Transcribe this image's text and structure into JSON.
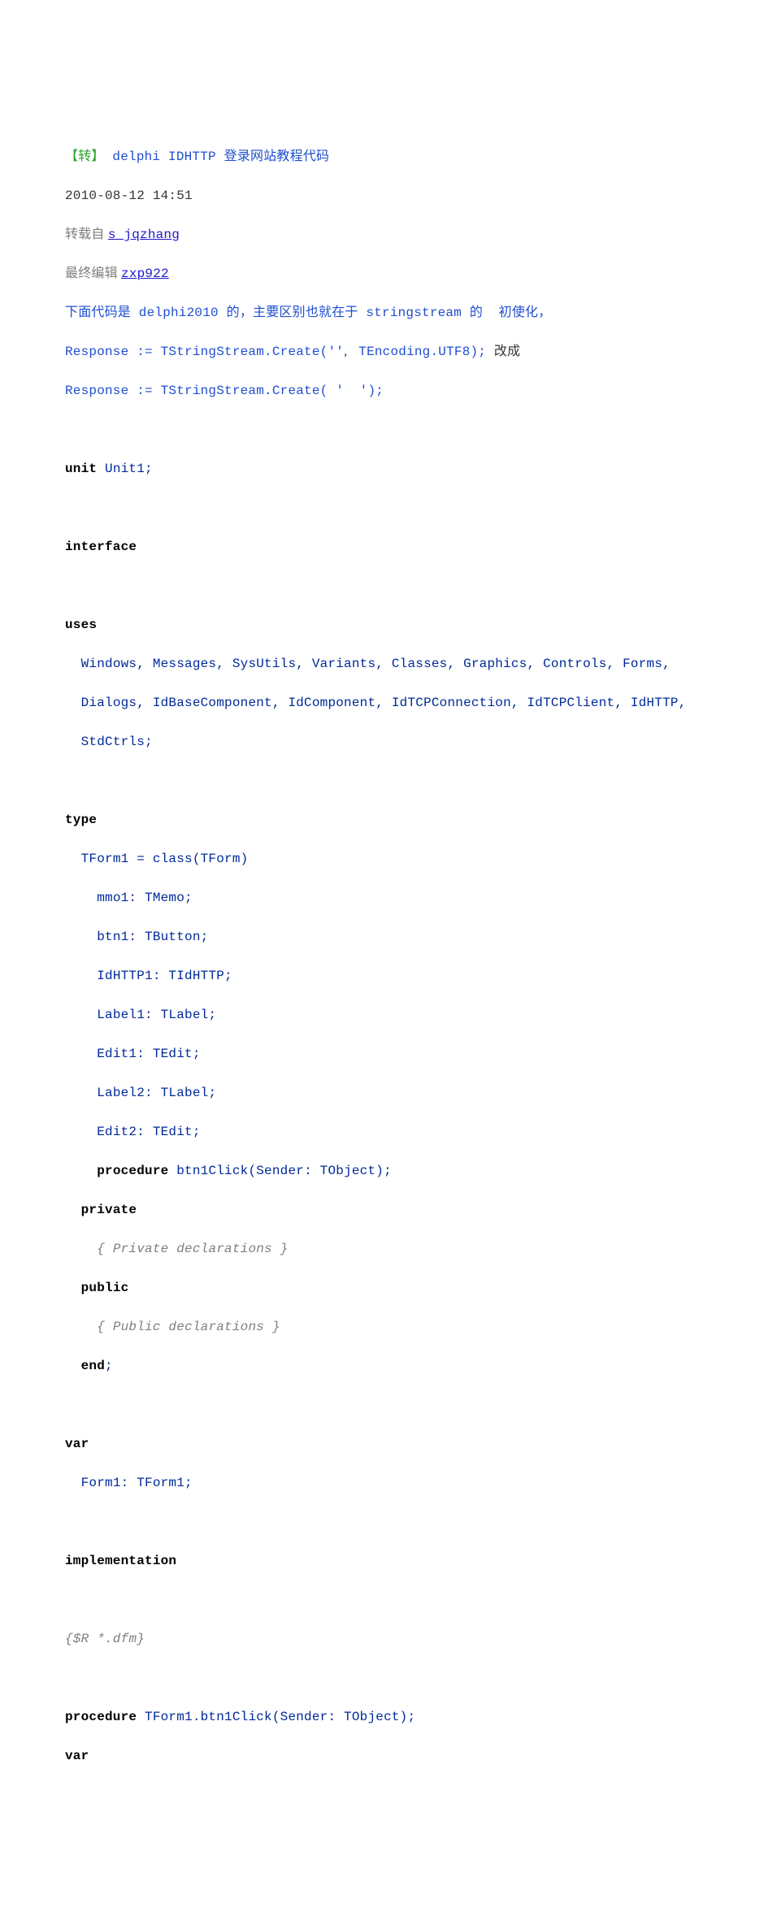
{
  "header": {
    "tag_bracket_l": "【转】",
    "title": " delphi IDHTTP 登录网站教程代码",
    "date": "2010-08-12 14:51",
    "reprint_label": "转载自 ",
    "reprint_link": "s_jqzhang",
    "edit_label": "最终编辑 ",
    "edit_link": "zxp922",
    "desc": "下面代码是 delphi2010 的，主要区别也就在于 stringstream 的  初使化，",
    "line6a": "Response := TStringStream.Create(''",
    "line6b": ", ",
    "line6c": " TEncoding.UTF8); ",
    "line6d": "改成",
    "line7": "Response := TStringStream.Create( '  ');"
  },
  "code": {
    "unit_kw": "unit",
    "unit_name": " Unit1;",
    "interface_kw": "interface",
    "uses_kw": "uses",
    "uses_l1": "  Windows, Messages, SysUtils, Variants, Classes, Graphics, Controls, Forms,",
    "uses_l2": "  Dialogs, IdBaseComponent, IdComponent, IdTCPConnection, IdTCPClient, IdHTTP,",
    "uses_l3": "  StdCtrls;",
    "type_kw": "type",
    "cls_open": "  TForm1 = class(TForm)",
    "fld1": "    mmo1: TMemo;",
    "fld2": "    btn1: TButton;",
    "fld3": "    IdHTTP1: TIdHTTP;",
    "fld4": "    Label1: TLabel;",
    "fld5": "    Edit1: TEdit;",
    "fld6": "    Label2: TLabel;",
    "fld7": "    Edit2: TEdit;",
    "proc_kw": "    procedure",
    "proc_sig": " btn1Click(Sender: TObject);",
    "private_kw": "  private",
    "private_cmt": "    { Private declarations }",
    "public_kw": "  public",
    "public_cmt": "    { Public declarations }",
    "end_kw": "  end",
    "semi": ";",
    "var_kw": "var",
    "var_decl": "  Form1: TForm1;",
    "impl_kw": "implementation",
    "dfm_cmt": "{$R *.dfm}",
    "proc2_kw": "procedure",
    "proc2_sig": " TForm1.btn1Click(Sender: TObject);",
    "var2_kw": "var"
  }
}
